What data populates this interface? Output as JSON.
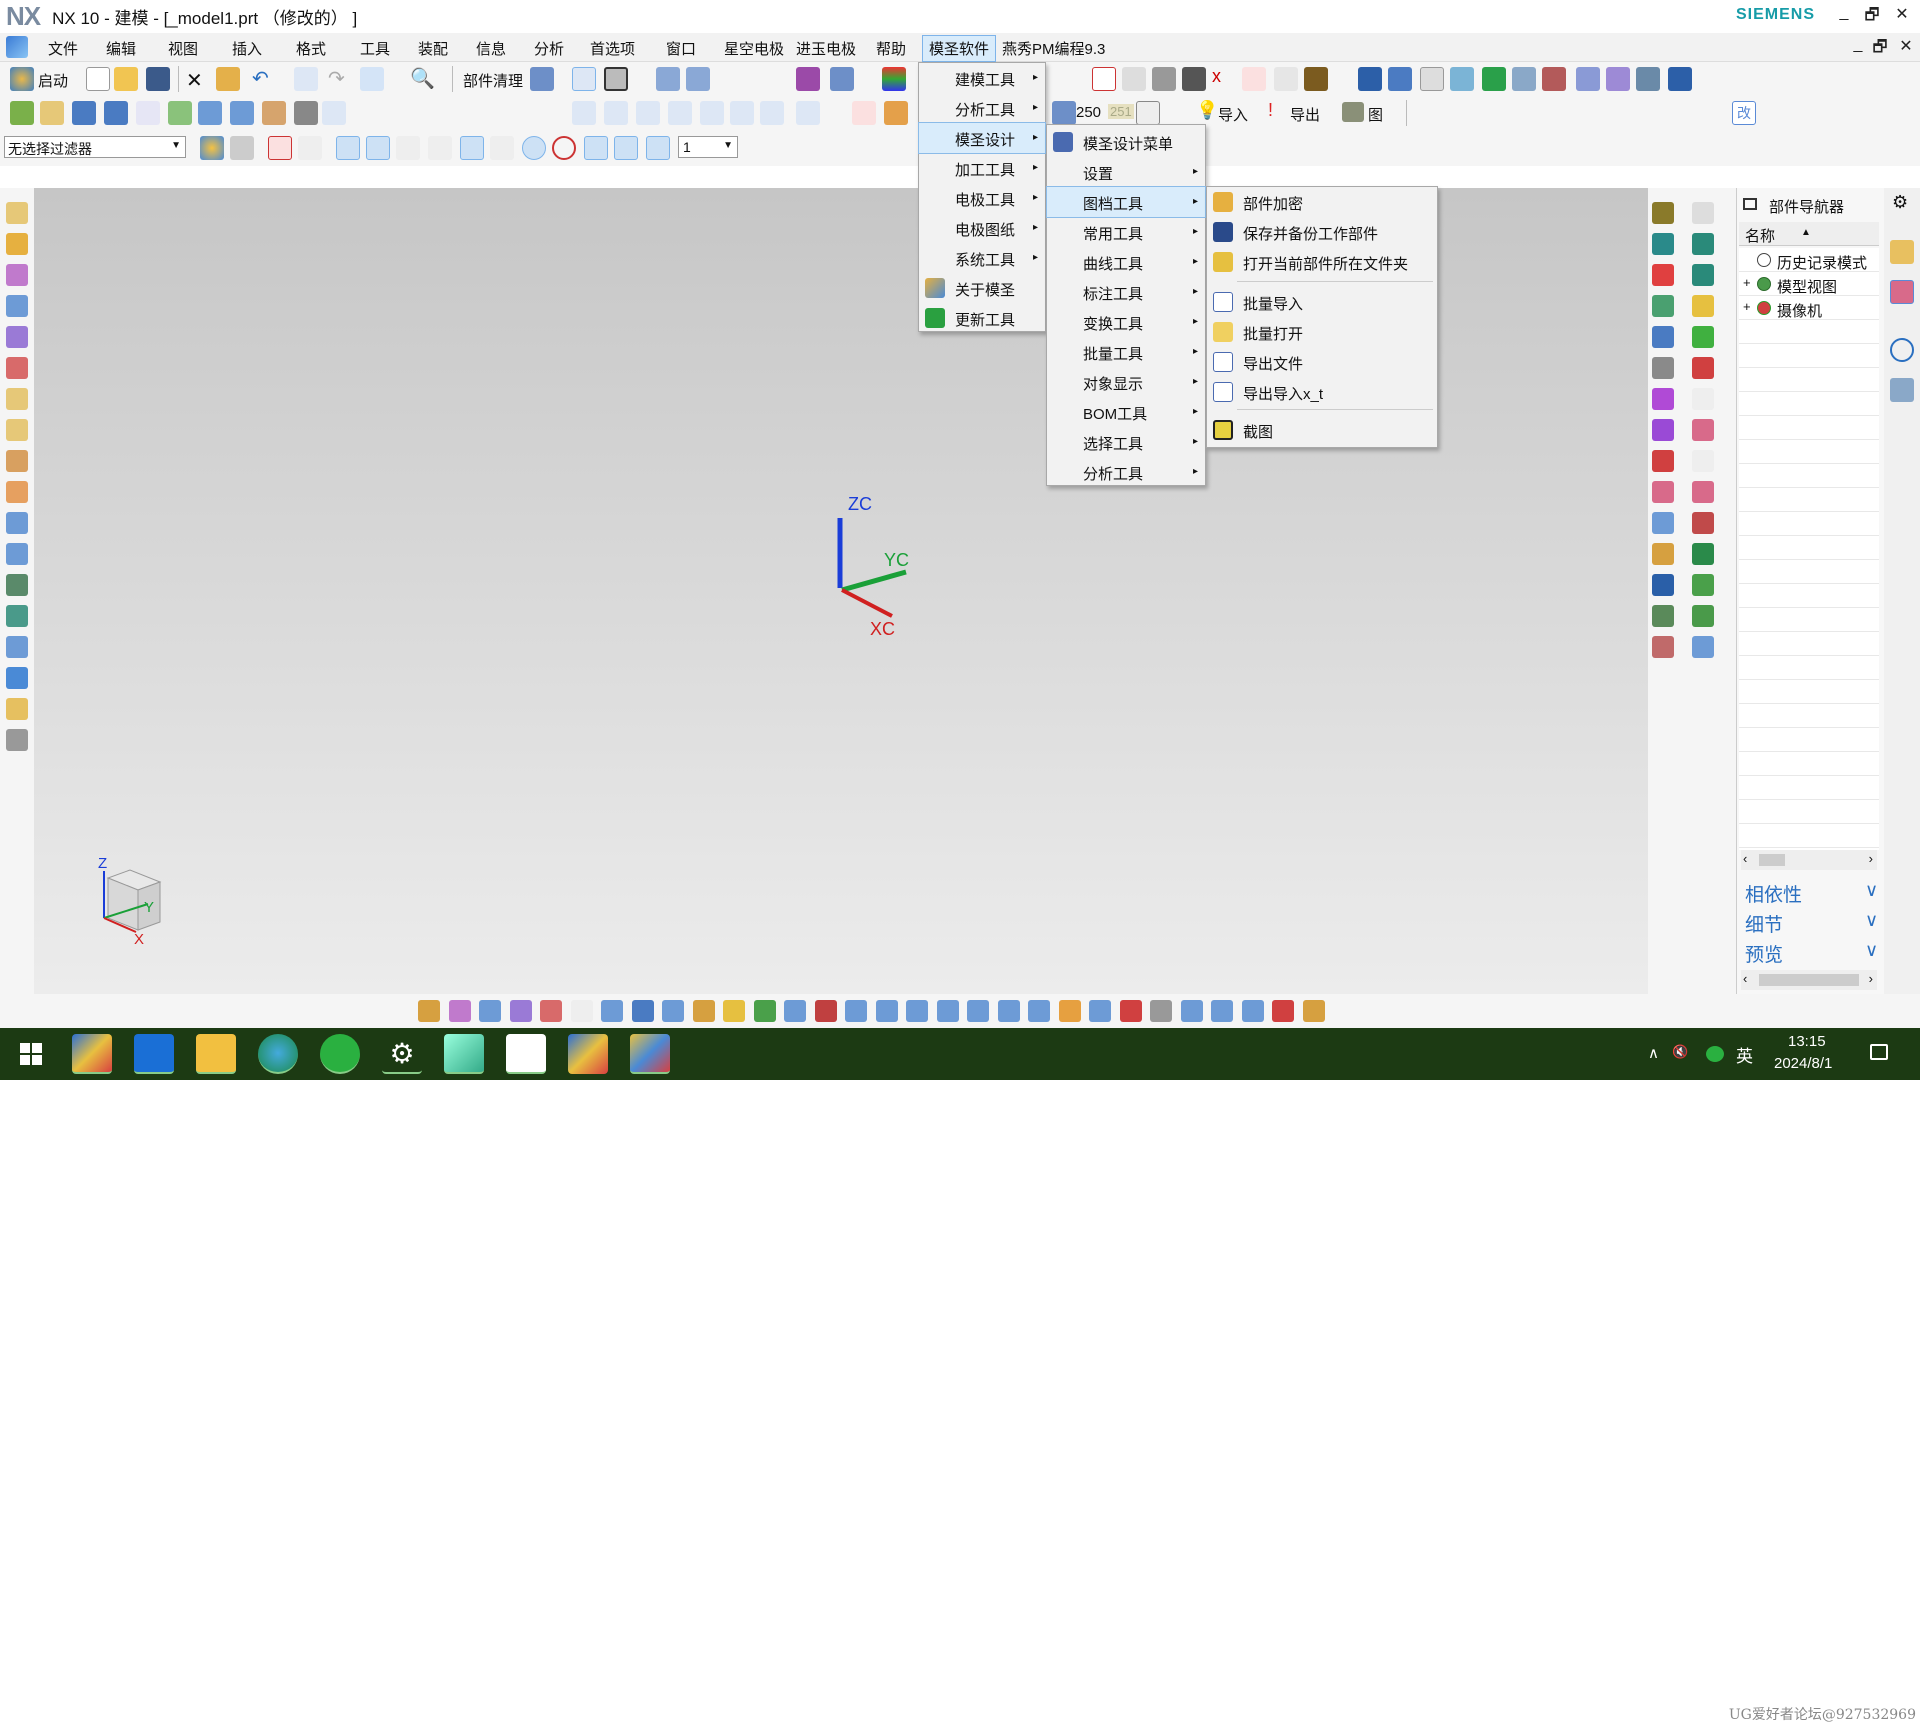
{
  "window": {
    "logo": "NX",
    "title": "NX 10 - 建模 - [_model1.prt （修改的） ]",
    "brand": "SIEMENS",
    "minimize": "_",
    "restore": "🗗",
    "close": "✕"
  },
  "menubar": {
    "items": [
      "文件",
      "编辑",
      "视图",
      "插入",
      "格式",
      "工具",
      "装配",
      "信息",
      "分析",
      "首选项",
      "窗口",
      "星空电极",
      "进玉电极",
      "帮助",
      "模圣软件",
      "燕秀PM编程9.3"
    ],
    "active_index": 14,
    "doc_minimize": "_",
    "doc_restore": "🗗",
    "doc_close": "✕"
  },
  "toolbar": {
    "start_label": "启动",
    "cleanup_label": "部件清理",
    "filter_value": "无选择过滤器",
    "layer_value": "1",
    "value_250": "250",
    "value_251": "251",
    "import_label": "导入",
    "export_label": "导出",
    "image_label": "图",
    "change_label": "改"
  },
  "palette_colors": [
    "#2f8fe6",
    "#e8a232",
    "#2ec92e",
    "#e8e8e8",
    "#2a2a2a",
    "#e6e02e",
    "#e02828",
    "#8a4fd6",
    "#2b9e3a",
    "#e89a9a"
  ],
  "menu_l1": {
    "items": [
      {
        "label": "建模工具",
        "icon": "",
        "arrow": "▸"
      },
      {
        "label": "分析工具",
        "icon": "",
        "arrow": "▸"
      },
      {
        "label": "模圣设计",
        "icon": "",
        "arrow": "▸"
      },
      {
        "label": "加工工具",
        "icon": "",
        "arrow": "▸"
      },
      {
        "label": "电极工具",
        "icon": "",
        "arrow": "▸"
      },
      {
        "label": "电极图纸",
        "icon": "",
        "arrow": "▸"
      },
      {
        "label": "系统工具",
        "icon": "",
        "arrow": "▸"
      },
      {
        "label": "关于模圣",
        "icon": "house-icon",
        "arrow": ""
      },
      {
        "label": "更新工具",
        "icon": "up-arrow-icon",
        "arrow": ""
      }
    ],
    "highlight_index": 2
  },
  "menu_l2": {
    "items": [
      {
        "label": "模圣设计菜单",
        "icon": "menu-design-icon",
        "arrow": ""
      },
      {
        "label": "设置",
        "icon": "",
        "arrow": "▸"
      },
      {
        "label": "图档工具",
        "icon": "",
        "arrow": "▸"
      },
      {
        "label": "常用工具",
        "icon": "",
        "arrow": "▸"
      },
      {
        "label": "曲线工具",
        "icon": "",
        "arrow": "▸"
      },
      {
        "label": "标注工具",
        "icon": "",
        "arrow": "▸"
      },
      {
        "label": "变换工具",
        "icon": "",
        "arrow": "▸"
      },
      {
        "label": "批量工具",
        "icon": "",
        "arrow": "▸"
      },
      {
        "label": "对象显示",
        "icon": "",
        "arrow": "▸"
      },
      {
        "label": "BOM工具",
        "icon": "",
        "arrow": "▸"
      },
      {
        "label": "选择工具",
        "icon": "",
        "arrow": "▸"
      },
      {
        "label": "分析工具",
        "icon": "",
        "arrow": "▸"
      }
    ],
    "highlight_index": 2
  },
  "menu_l3": {
    "items": [
      {
        "label": "部件加密",
        "icon": "lock-coins-icon"
      },
      {
        "label": "保存并备份工作部件",
        "icon": "save-icon"
      },
      {
        "label": "打开当前部件所在文件夹",
        "icon": "folder-user-icon"
      },
      {
        "label": "批量导入",
        "icon": "document-icon"
      },
      {
        "label": "批量打开",
        "icon": "open-folder-icon"
      },
      {
        "label": "导出文件",
        "icon": "document-icon"
      },
      {
        "label": "导出导入x_t",
        "icon": "document-icon"
      },
      {
        "label": "截图",
        "icon": "screenshot-icon"
      }
    ]
  },
  "axes": {
    "zc": "ZC",
    "yc": "YC",
    "xc": "XC",
    "z": "Z",
    "y": "Y",
    "x": "X"
  },
  "navigator": {
    "title": "部件导航器",
    "column": "名称",
    "sort_arrow": "▲",
    "items": [
      "历史记录模式",
      "模型视图",
      "摄像机"
    ],
    "sections": [
      "相依性",
      "细节",
      "预览"
    ]
  },
  "taskbar": {
    "ime": "英",
    "time": "13:15",
    "date": "2024/8/1",
    "tray_up": "∧",
    "volume": "🔇"
  },
  "watermark": "UG爱好者论坛@927532969"
}
